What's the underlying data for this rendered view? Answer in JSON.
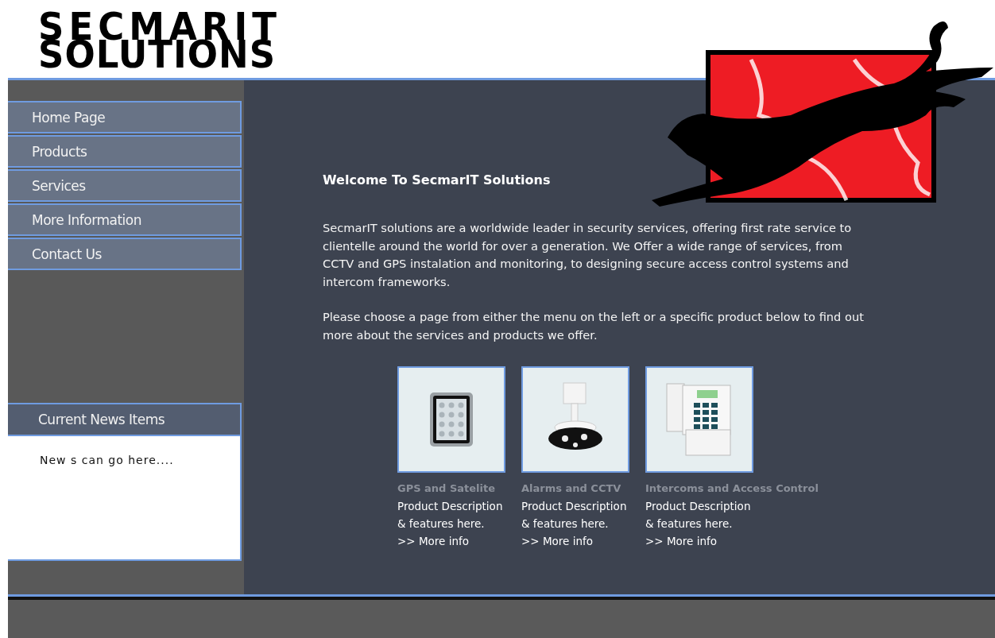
{
  "logo": {
    "lines": [
      "SECMARIT",
      "SOLUTIONS"
    ]
  },
  "menu": [
    {
      "label": "Home Page"
    },
    {
      "label": "Products"
    },
    {
      "label": "Services"
    },
    {
      "label": "More Information"
    },
    {
      "label": "Contact Us"
    }
  ],
  "news": {
    "title": "Current News Items",
    "text": "New s can go here...."
  },
  "welcome": {
    "title": "Welcome To SecmarIT Solutions",
    "paragraphs": [
      "SecmarIT solutions are a worldwide leader in security services, offering first rate service to clientelle around the world for over a generation. We Offer a wide range of services, from CCTV and GPS instalation and monitoring, to designing secure access control systems and intercom frameworks.",
      "Please choose a page from either the menu on the left or a specific product below to find out more about the services and products we offer."
    ]
  },
  "products": [
    {
      "kind": "keypad",
      "title": "GPS and Satelite",
      "description": [
        "Product Description",
        "&  features here."
      ],
      "link": ">>  More info"
    },
    {
      "kind": "camera",
      "title": "Alarms and CCTV",
      "description": [
        "Product Description",
        "&  features here."
      ],
      "link": ">>  More info"
    },
    {
      "kind": "alarm-panel",
      "title": "Intercoms and Access Control",
      "description": [
        "Product Description",
        "&  features here."
      ],
      "link": ">>  More info"
    }
  ]
}
